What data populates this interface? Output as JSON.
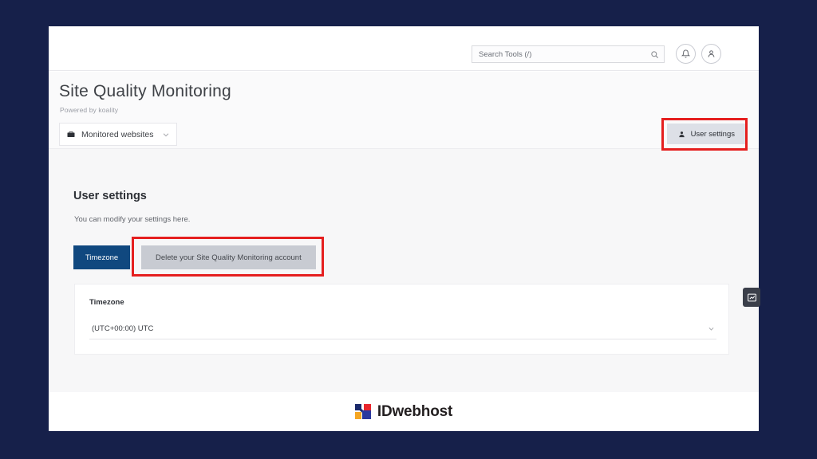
{
  "theme": {
    "backdrop": "#16204a",
    "page_bg": "#ffffff",
    "content_bg": "#f7f7f8",
    "primary_blue": "#10487f",
    "secondary_gray": "#c8cbd2",
    "highlight_red": "#e51f1f"
  },
  "topbar": {
    "search": {
      "placeholder": "Search Tools (/)",
      "value": "",
      "icon": "search-icon"
    },
    "notifications_icon": "bell-icon",
    "account_icon": "user-avatar-icon"
  },
  "header": {
    "title": "Site Quality Monitoring",
    "subtitle": "Powered by koality"
  },
  "navrow": {
    "workspace_select": {
      "icon": "briefcase-icon",
      "label": "Monitored websites",
      "chevron": "chevron-down-icon"
    },
    "user_settings_button": {
      "icon": "user-icon",
      "label": "User settings"
    }
  },
  "main": {
    "section_title": "User settings",
    "section_subtitle": "You can modify your settings here.",
    "tabs": [
      {
        "label": "Timezone",
        "state": "active"
      },
      {
        "label": "Delete your Site Quality Monitoring account",
        "state": "inactive"
      }
    ],
    "timezone_card": {
      "label": "Timezone",
      "selected_value": "(UTC+00:00) UTC",
      "chevron": "chevron-down-icon"
    }
  },
  "side_widget": {
    "icon": "chart-analytics-icon"
  },
  "footer": {
    "brand_name": "IDwebhost",
    "mark_colors": {
      "navy": "#1b2a6b",
      "red": "#e8262d",
      "amber": "#f5a623",
      "blue": "#2b3a9e"
    }
  },
  "annotations": [
    {
      "name": "user-settings-highlight",
      "target": "User settings",
      "color": "#e51f1f"
    },
    {
      "name": "delete-account-highlight",
      "target": "Delete your Site Quality Monitoring account",
      "color": "#e51f1f"
    }
  ]
}
